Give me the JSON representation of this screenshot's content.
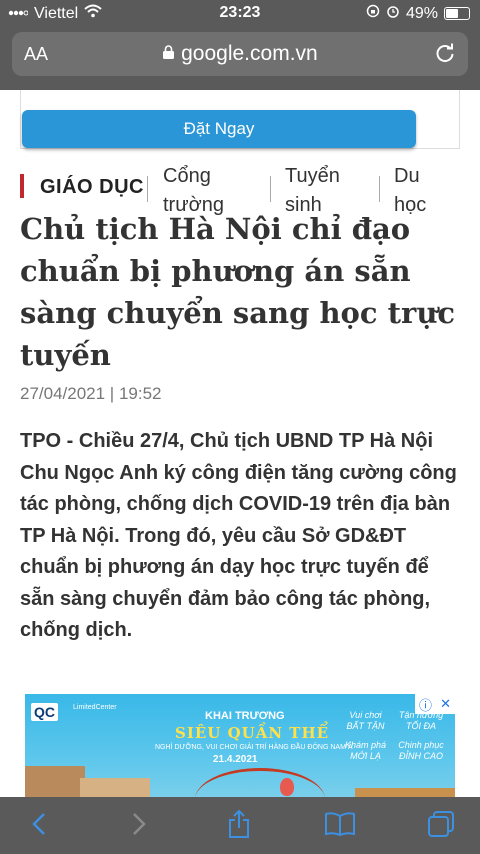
{
  "status_bar": {
    "carrier": "Viettel",
    "time": "23:23",
    "battery": "49%",
    "battery_level": 0.49
  },
  "url_bar": {
    "text_size_button": "AA",
    "domain": "google.com.vn"
  },
  "ad_cta": {
    "label": "Đặt Ngay"
  },
  "category_nav": {
    "section": "GIÁO DỤC",
    "items": [
      {
        "label": "Cổng trường"
      },
      {
        "label": "Tuyển sinh"
      },
      {
        "label": "Du học"
      }
    ]
  },
  "article": {
    "headline": "Chủ tịch Hà Nội chỉ đạo chuẩn bị phương án sẵn sàng chuyển sang học trực tuyến",
    "date": "27/04/2021 | 19:52",
    "lead": "TPO - Chiều 27/4, Chủ tịch UBND TP Hà Nội Chu Ngọc Anh ký công điện tăng cường công tác phòng, chống dịch COVID-19 trên địa bàn TP Hà Nội. Trong đó, yêu cầu Sở GD&ĐT chuẩn bị phương án dạy học trực tuyến để sẵn sàng chuyển đảm bảo công tác phòng, chống dịch."
  },
  "banner_ad": {
    "logo": "QC",
    "logo_sub": "LimitedCenter",
    "line1": "KHAI TRƯƠNG",
    "line2": "SIÊU QUẦN THỂ",
    "line3": "NGHỈ DƯỠNG, VUI CHƠI GIẢI TRÍ HÀNG ĐẦU ĐÔNG NAM Á",
    "date": "21.4.2021",
    "tag1": "Vui chơi BẤT TẬN",
    "tag2": "Tận hưởng TỐI ĐA",
    "tag3": "Khám phá MỚI LẠ",
    "tag4": "Chinh phục ĐỈNH CAO"
  },
  "colors": {
    "chrome": "#5a5a5a",
    "url_field": "#707070",
    "cta": "#2a96d8",
    "section_mark": "#c0282d",
    "toolbar_icons": "#3d8fe0"
  }
}
